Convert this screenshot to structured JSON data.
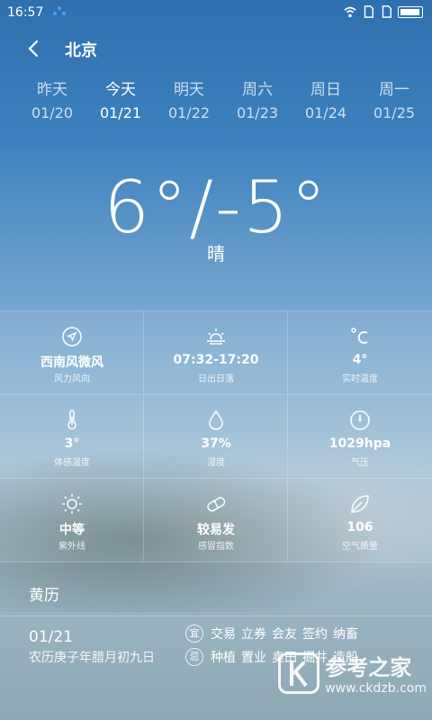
{
  "status": {
    "time": "16:57"
  },
  "header": {
    "city": "北京"
  },
  "days": [
    {
      "name": "昨天",
      "date": "01/20"
    },
    {
      "name": "今天",
      "date": "01/21"
    },
    {
      "name": "明天",
      "date": "01/22"
    },
    {
      "name": "周六",
      "date": "01/23"
    },
    {
      "name": "周日",
      "date": "01/24"
    },
    {
      "name": "周一",
      "date": "01/25"
    }
  ],
  "today": {
    "temp": "6°/-5°",
    "condition": "晴"
  },
  "details": [
    {
      "icon": "navigation-icon",
      "value": "西南风微风",
      "label": "风力风向"
    },
    {
      "icon": "sunrise-icon",
      "value": "07:32-17:20",
      "label": "日出日落"
    },
    {
      "icon": "celsius-icon",
      "value": "4°",
      "label": "实时温度"
    },
    {
      "icon": "thermometer-icon",
      "value": "3°",
      "label": "体感温度"
    },
    {
      "icon": "water-drop-icon",
      "value": "37%",
      "label": "湿度"
    },
    {
      "icon": "gauge-icon",
      "value": "1029hpa",
      "label": "气压"
    },
    {
      "icon": "sun-icon",
      "value": "中等",
      "label": "紫外线"
    },
    {
      "icon": "pill-icon",
      "value": "较易发",
      "label": "感冒指数"
    },
    {
      "icon": "leaf-icon",
      "value": "106",
      "label": "空气质量"
    }
  ],
  "almanac": {
    "title": "黄历",
    "date": "01/21",
    "lunar": "农历庚子年腊月初九日",
    "yi_label": "宜",
    "yi": [
      "交易",
      "立券",
      "会友",
      "签约",
      "纳畜"
    ],
    "ji_label": "忌",
    "ji": [
      "种植",
      "置业",
      "卖田",
      "掘井",
      "造船"
    ]
  },
  "watermark": {
    "name": "参考之家",
    "url": "www.ckdzb.com"
  }
}
